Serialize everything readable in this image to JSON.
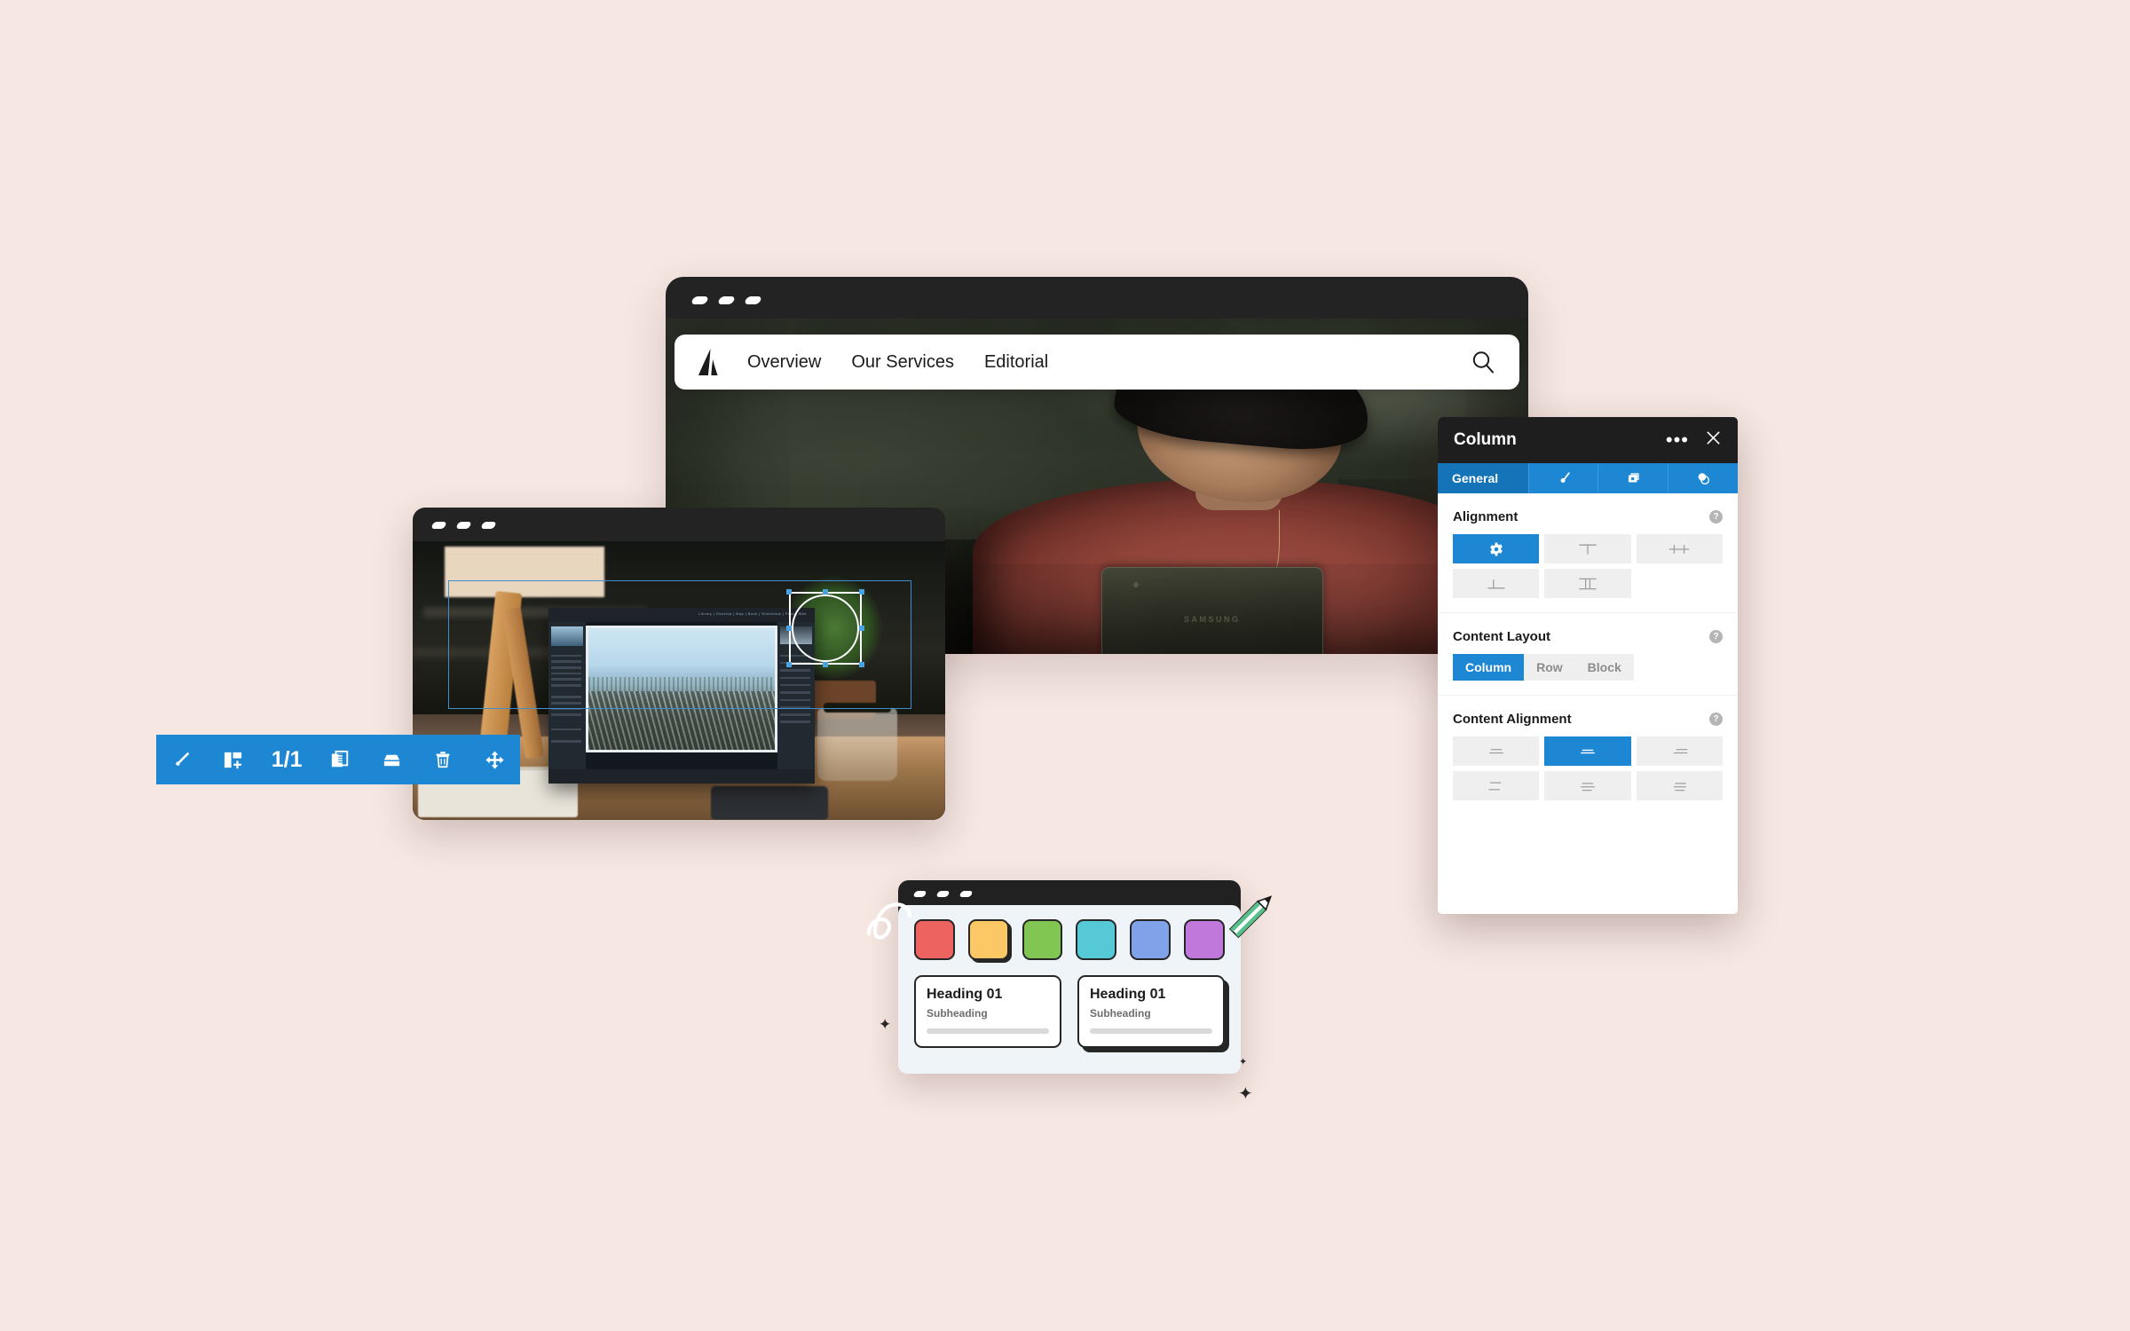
{
  "canvas": {
    "background": "#F6E7E3"
  },
  "main_browser": {
    "name": "website-preview-window",
    "nav": {
      "logo_icon": "atlassian-a-logo-icon",
      "links": [
        "Overview",
        "Our Services",
        "Editorial"
      ],
      "search_icon": "search-icon"
    },
    "code_mark": "</>",
    "window_dots": [
      "dot-1",
      "dot-2",
      "dot-3"
    ]
  },
  "editor_window": {
    "name": "image-editor-window",
    "window_dots": [
      "dot-1",
      "dot-2",
      "dot-3"
    ],
    "selection": {
      "handle_icon": "circle-crop-handle-icon"
    },
    "toolbar": {
      "accent": "#1E87D3",
      "items": [
        {
          "icon": "brush-icon",
          "label": "Brush"
        },
        {
          "icon": "add-section-icon",
          "label": "Add section"
        },
        {
          "icon": "page-counter",
          "label": "1/1"
        },
        {
          "icon": "duplicate-icon",
          "label": "Duplicate"
        },
        {
          "icon": "archive-icon",
          "label": "Archive"
        },
        {
          "icon": "trash-icon",
          "label": "Delete"
        },
        {
          "icon": "move-icon",
          "label": "Move"
        }
      ],
      "page_counter": "1/1"
    }
  },
  "property_panel": {
    "name": "column-properties-panel",
    "title": "Column",
    "more_icon": "more-horizontal-icon",
    "close_icon": "close-icon",
    "tabs": [
      {
        "label": "General",
        "icon": "",
        "active": true
      },
      {
        "label": "",
        "icon": "brush-tab-icon",
        "active": false
      },
      {
        "label": "",
        "icon": "layers-tab-icon",
        "active": false
      },
      {
        "label": "",
        "icon": "effects-tab-icon",
        "active": false
      }
    ],
    "sections": [
      {
        "label": "Alignment",
        "help_icon": "help-icon",
        "help_glyph": "?",
        "options": [
          {
            "icon": "gear-icon",
            "active": true
          },
          {
            "icon": "align-top-icon",
            "active": false
          },
          {
            "icon": "align-center-horizontal-icon",
            "active": false
          },
          {
            "icon": "align-bottom-icon",
            "active": false
          },
          {
            "icon": "align-stretch-vertical-icon",
            "active": false
          }
        ]
      }
    ],
    "content_layout": {
      "label": "Content Layout",
      "help_glyph": "?",
      "options": [
        "Column",
        "Row",
        "Block"
      ],
      "selected": "Column"
    },
    "content_alignment": {
      "label": "Content Alignment",
      "help_glyph": "?",
      "options": [
        {
          "icon": "content-align-top-left-icon",
          "active": false
        },
        {
          "icon": "content-align-middle-center-icon",
          "active": true
        },
        {
          "icon": "content-align-top-right-icon",
          "active": false
        },
        {
          "icon": "content-align-split-left-icon",
          "active": false
        },
        {
          "icon": "content-align-bottom-center-icon",
          "active": false
        },
        {
          "icon": "content-align-bottom-right-icon",
          "active": false
        }
      ],
      "selected_index": 1
    },
    "accent_color": "#1E87D3"
  },
  "design_card": {
    "name": "style-palette-card",
    "window_dots": [
      "dot-1",
      "dot-2",
      "dot-3"
    ],
    "swatches": [
      {
        "color": "#EC6360",
        "selected": false
      },
      {
        "color": "#FCC765",
        "selected": true
      },
      {
        "color": "#81C653",
        "selected": false
      },
      {
        "color": "#55CAD6",
        "selected": false
      },
      {
        "color": "#7FA2E8",
        "selected": false
      },
      {
        "color": "#C078DB",
        "selected": false
      }
    ],
    "cards": [
      {
        "heading": "Heading 01",
        "subheading": "Subheading",
        "selected": false
      },
      {
        "heading": "Heading 01",
        "subheading": "Subheading",
        "selected": true
      }
    ]
  },
  "decorations": {
    "squiggle_icon": "squiggle-loop-icon",
    "pencil_icon": "pencil-icon",
    "sparkles": [
      "sparkle-icon",
      "sparkle-icon",
      "sparkle-icon"
    ]
  }
}
